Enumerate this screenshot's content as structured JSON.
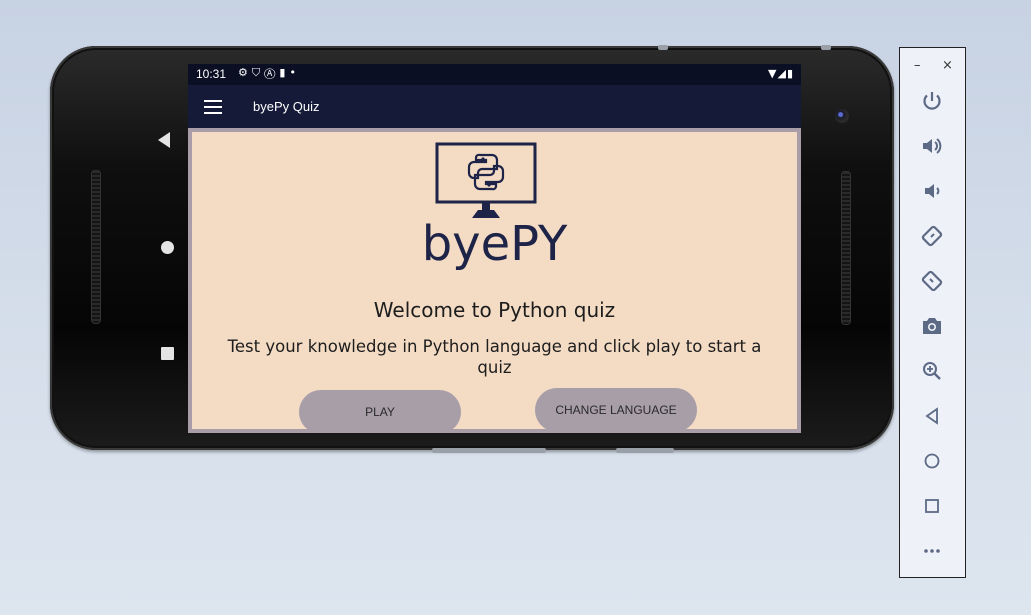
{
  "status_bar": {
    "time": "10:31",
    "left_icons": [
      "settings-icon",
      "shield-icon",
      "a-icon",
      "sd-card-icon",
      "dot-icon"
    ],
    "right_icons": [
      "wifi-icon",
      "signal-icon",
      "battery-icon"
    ]
  },
  "app_bar": {
    "title": "byePy Quiz"
  },
  "main": {
    "brand": "byePY",
    "welcome": "Welcome to Python quiz",
    "description": "Test your knowledge in Python language and click play to start a quiz",
    "play_label": "PLAY",
    "change_language_label": "CHANGE LANGUAGE"
  },
  "emulator_toolbar": {
    "minimize": "–",
    "close": "×",
    "items": [
      "power-icon",
      "volume-up-icon",
      "volume-down-icon",
      "rotate-left-icon",
      "rotate-right-icon",
      "camera-icon",
      "zoom-icon",
      "back-icon",
      "home-icon",
      "overview-icon",
      "more-icon"
    ]
  },
  "colors": {
    "app_bar": "#141a38",
    "status_bar": "#0b0f24",
    "content_bg": "#f3dbc4",
    "button": "#a79ea8",
    "brand_text": "#1e2348"
  }
}
